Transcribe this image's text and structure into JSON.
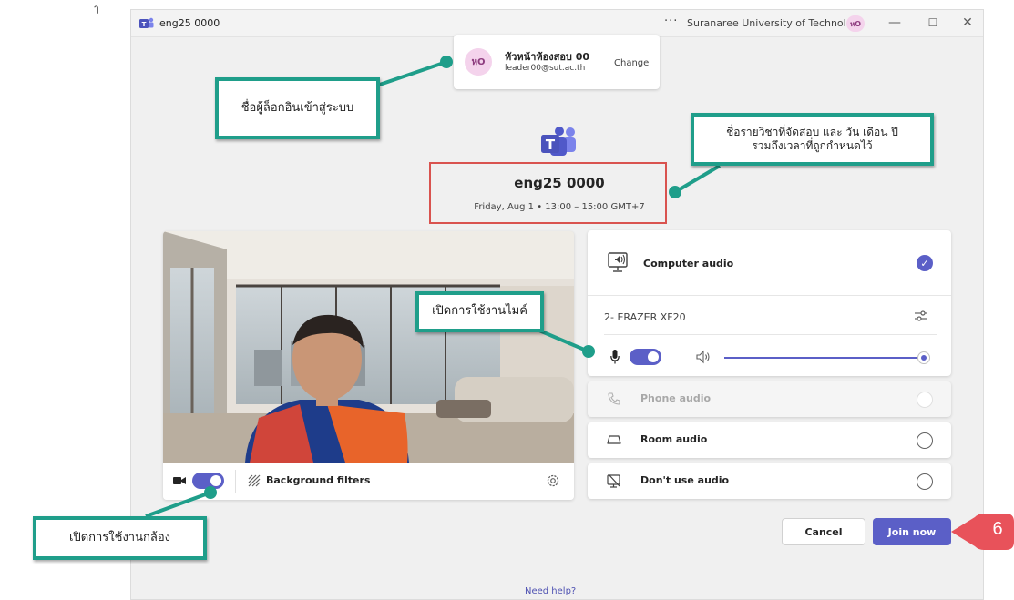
{
  "stray_mark": "ๅ",
  "window": {
    "title": "eng25 0000",
    "more_label": "···",
    "org_name": "Suranaree University of Technology",
    "avatar_initials": "หO",
    "minimize": "—",
    "maximize": "☐",
    "close": "✕"
  },
  "account": {
    "initials": "หO",
    "name": "หัวหน้าห้องสอบ 00",
    "email": "leader00@sut.ac.th",
    "change_label": "Change"
  },
  "meeting": {
    "title": "eng25 0000",
    "datetime": "Friday, Aug 1 • 13:00 – 15:00 GMT+7"
  },
  "video": {
    "camera_on": true,
    "background_filters_label": "Background filters"
  },
  "audio": {
    "computer_audio_label": "Computer audio",
    "computer_audio_selected": true,
    "device_name": "2- ERAZER XF20",
    "mic_on": true,
    "volume": 1.0,
    "options": [
      {
        "label": "Phone audio",
        "disabled": true
      },
      {
        "label": "Room audio",
        "disabled": false
      },
      {
        "label": "Don't use audio",
        "disabled": false
      }
    ]
  },
  "buttons": {
    "cancel": "Cancel",
    "join": "Join now"
  },
  "help_link": "Need help?",
  "annotations": {
    "login": "ชื่อผู้ล็อกอินเข้าสู่ระบบ",
    "course_line1": "ชื่อรายวิชาที่จัดสอบ และ วัน เดือน ปี",
    "course_line2": "รวมถึงเวลาที่ถูกกำหนดไว้",
    "mic": "เปิดการใช้งานไมค์",
    "camera": "เปิดการใช้งานกล้อง",
    "step": "6"
  },
  "colors": {
    "accent": "#5b5fc7",
    "callout_border": "#1f9e8a",
    "highlight_box": "#d9534f",
    "step_badge": "#e8525a"
  }
}
